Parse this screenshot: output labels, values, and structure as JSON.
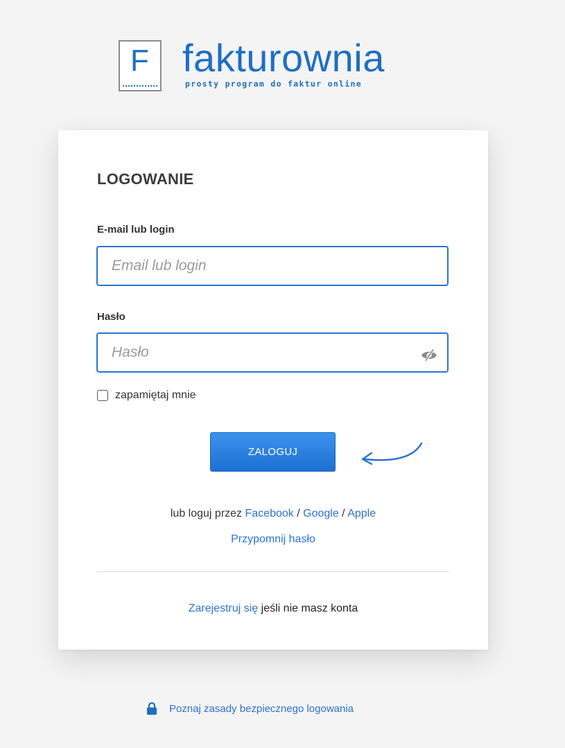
{
  "logo": {
    "letter": "F",
    "name": "fakturownia",
    "tagline": "prosty program do faktur online"
  },
  "login": {
    "title": "LOGOWANIE",
    "email_label": "E-mail lub login",
    "email_placeholder": "Email lub login",
    "email_value": "",
    "password_label": "Hasło",
    "password_placeholder": "Hasło",
    "password_value": "",
    "remember_label": "zapamiętaj mnie",
    "remember_checked": false,
    "submit_label": "ZALOGUJ",
    "social_prefix": "lub loguj przez",
    "social_facebook": "Facebook",
    "social_sep1": "/",
    "social_google": "Google",
    "social_sep2": "/",
    "social_apple": "Apple",
    "remind_label": "Przypomnij hasło",
    "register_link": "Zarejestruj się",
    "register_suffix": "jeśli nie masz konta"
  },
  "footer": {
    "security_label": "Poznaj zasady bezpiecznego logowania"
  },
  "colors": {
    "brand_blue": "#1f6fc3",
    "link_blue": "#2b72d3",
    "button_top": "#3b93ec",
    "button_bottom": "#1d6fd2",
    "background": "#f4f4f4"
  },
  "icons": {
    "password_toggle": "eye-slash-icon",
    "security": "lock-icon",
    "decoration": "curved-arrow-icon"
  }
}
